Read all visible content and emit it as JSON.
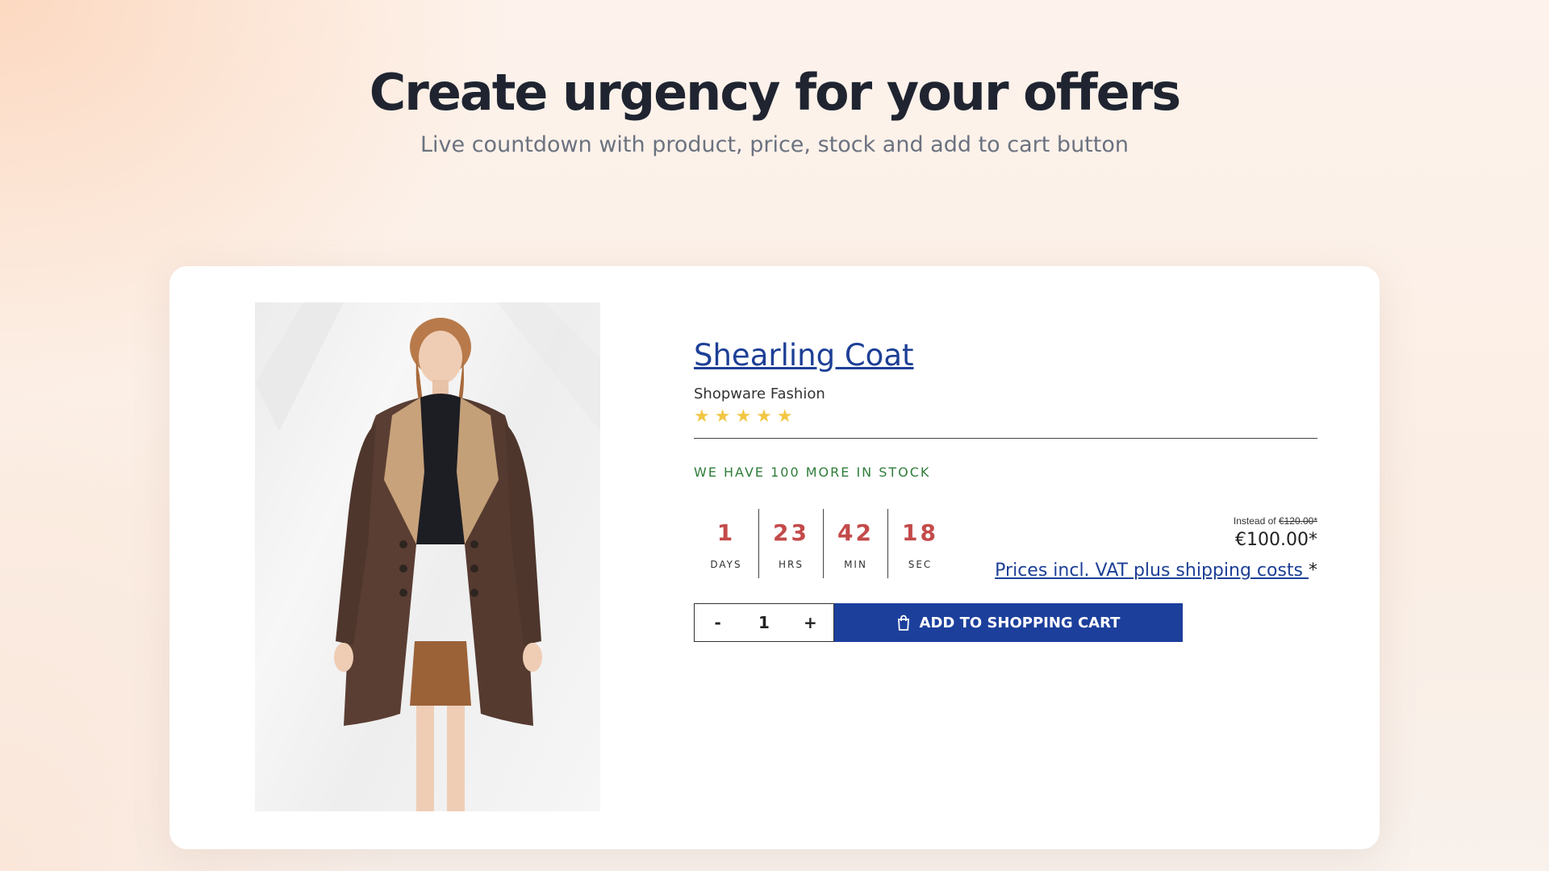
{
  "hero": {
    "title": "Create urgency for your offers",
    "subtitle": "Live countdown with product, price, stock and add to cart button"
  },
  "product": {
    "name": "Shearling Coat",
    "manufacturer": "Shopware Fashion",
    "rating": {
      "value": 5,
      "max": 5,
      "stars": "★★★★★"
    },
    "stock_text": "WE HAVE 100 MORE IN STOCK",
    "countdown": [
      {
        "value": "1",
        "label": "DAYS"
      },
      {
        "value": "23",
        "label": "HRS"
      },
      {
        "value": "42",
        "label": "MIN"
      },
      {
        "value": "18",
        "label": "SEC"
      }
    ],
    "price": {
      "instead_prefix": "Instead of",
      "old_price": "€120.00*",
      "current_price": "€100.00*",
      "vat_link": "Prices incl. VAT plus shipping costs ",
      "vat_suffix": "*"
    },
    "quantity": {
      "minus": "-",
      "value": "1",
      "plus": "+"
    },
    "cart_button": "ADD TO SHOPPING CART"
  },
  "colors": {
    "accent": "#1c3f9c",
    "countdown": "#c44a4a",
    "stock": "#2e7d3a",
    "star": "#f2c744"
  }
}
